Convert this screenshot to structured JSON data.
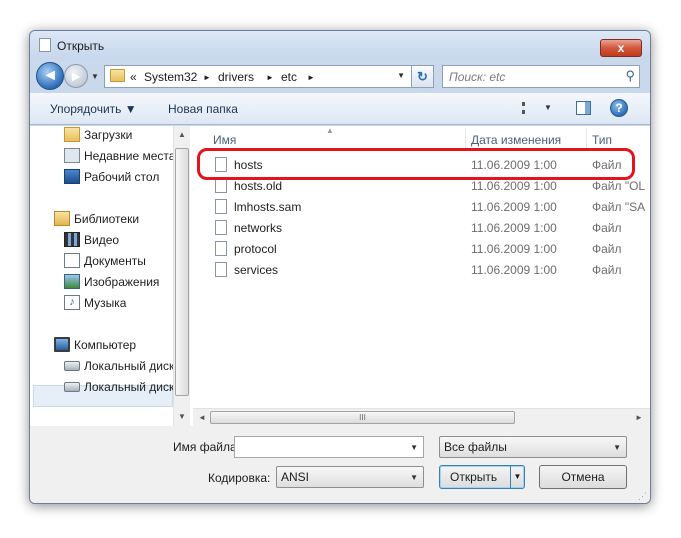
{
  "window": {
    "title": "Открыть",
    "close_symbol": "x"
  },
  "nav_buttons": {
    "back_icon": "◄",
    "forward_icon": "►"
  },
  "address": {
    "prefix": "«",
    "segments": [
      "System32",
      "drivers",
      "etc"
    ],
    "separator": "►"
  },
  "search": {
    "placeholder": "Поиск: etc"
  },
  "toolbar": {
    "organize_label": "Упорядочить ▼",
    "new_folder_label": "Новая папка",
    "help_symbol": "?"
  },
  "sidebar": {
    "items": [
      {
        "label": "Загрузки",
        "icon": "downloads-icon"
      },
      {
        "label": "Недавние места",
        "icon": "recent-places-icon"
      },
      {
        "label": "Рабочий стол",
        "icon": "desktop-icon"
      },
      {
        "label": "Библиотеки",
        "icon": "libraries-icon"
      },
      {
        "label": "Видео",
        "icon": "video-icon"
      },
      {
        "label": "Документы",
        "icon": "documents-icon"
      },
      {
        "label": "Изображения",
        "icon": "images-icon"
      },
      {
        "label": "Музыка",
        "icon": "music-icon"
      },
      {
        "label": "Компьютер",
        "icon": "computer-icon"
      },
      {
        "label": "Локальный диск",
        "icon": "local-disk-icon"
      },
      {
        "label": "Локальный диск",
        "icon": "local-disk-icon"
      }
    ],
    "selected_index": 9
  },
  "filelist": {
    "columns": {
      "name": "Имя",
      "date": "Дата изменения",
      "type": "Тип"
    },
    "rows": [
      {
        "name": "hosts",
        "date": "11.06.2009 1:00",
        "type": "Файл"
      },
      {
        "name": "hosts.old",
        "date": "11.06.2009 1:00",
        "type": "Файл \"OL"
      },
      {
        "name": "lmhosts.sam",
        "date": "11.06.2009 1:00",
        "type": "Файл \"SA"
      },
      {
        "name": "networks",
        "date": "11.06.2009 1:00",
        "type": "Файл"
      },
      {
        "name": "protocol",
        "date": "11.06.2009 1:00",
        "type": "Файл"
      },
      {
        "name": "services",
        "date": "11.06.2009 1:00",
        "type": "Файл"
      }
    ],
    "highlighted_row": 0,
    "highlight_color": "#e3141b",
    "scroll_grip": "III"
  },
  "bottom": {
    "filename_label": "Имя файла:",
    "filename_value": "",
    "filter_value": "Все файлы",
    "encoding_label": "Кодировка:",
    "encoding_value": "ANSI",
    "open_label": "Открыть",
    "cancel_label": "Отмена"
  }
}
